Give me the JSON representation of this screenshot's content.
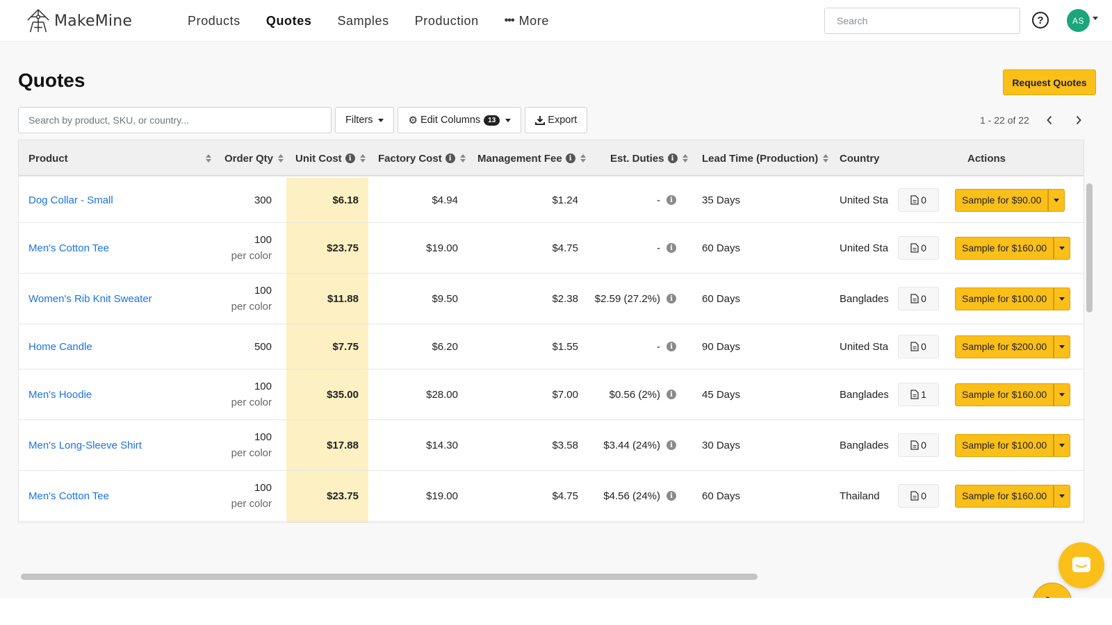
{
  "app": {
    "name": "MakeMine"
  },
  "nav": {
    "items": [
      {
        "label": "Products",
        "active": false
      },
      {
        "label": "Quotes",
        "active": true
      },
      {
        "label": "Samples",
        "active": false
      },
      {
        "label": "Production",
        "active": false
      }
    ],
    "more_label": "More",
    "search_placeholder": "Search",
    "user_initials": "AS",
    "avatar_color": "#1aa57b"
  },
  "page": {
    "title": "Quotes",
    "request_button": "Request Quotes",
    "accent_color": "#fbbf1a"
  },
  "toolbar": {
    "search_placeholder": "Search by product, SKU, or country...",
    "filters_label": "Filters",
    "edit_columns_label": "Edit Columns",
    "edit_columns_count": "13",
    "export_label": "Export",
    "pagination": "1 - 22 of 22"
  },
  "table": {
    "columns": {
      "product": "Product",
      "order_qty": "Order Qty",
      "unit_cost": "Unit Cost",
      "factory_cost": "Factory Cost",
      "management_fee": "Management Fee",
      "est_duties": "Est. Duties",
      "lead_time": "Lead Time (Production)",
      "country": "Country",
      "actions": "Actions"
    },
    "rows": [
      {
        "product": "Dog Collar - Small",
        "qty": "300",
        "qty_sub": "",
        "unit_cost": "$6.18",
        "factory_cost": "$4.94",
        "management_fee": "$1.24",
        "est_duties": "-",
        "lead_time": "35 Days",
        "country": "United States",
        "docs": "0",
        "sample": "Sample for $90.00"
      },
      {
        "product": "Men's Cotton Tee",
        "qty": "100",
        "qty_sub": "per color",
        "unit_cost": "$23.75",
        "factory_cost": "$19.00",
        "management_fee": "$4.75",
        "est_duties": "-",
        "lead_time": "60 Days",
        "country": "United States",
        "docs": "0",
        "sample": "Sample for $160.00"
      },
      {
        "product": "Women's Rib Knit Sweater",
        "qty": "100",
        "qty_sub": "per color",
        "unit_cost": "$11.88",
        "factory_cost": "$9.50",
        "management_fee": "$2.38",
        "est_duties": "$2.59 (27.2%)",
        "lead_time": "60 Days",
        "country": "Bangladesh",
        "docs": "0",
        "sample": "Sample for $100.00"
      },
      {
        "product": "Home Candle",
        "qty": "500",
        "qty_sub": "",
        "unit_cost": "$7.75",
        "factory_cost": "$6.20",
        "management_fee": "$1.55",
        "est_duties": "-",
        "lead_time": "90 Days",
        "country": "United States",
        "docs": "0",
        "sample": "Sample for $200.00"
      },
      {
        "product": "Men's Hoodie",
        "qty": "100",
        "qty_sub": "per color",
        "unit_cost": "$35.00",
        "factory_cost": "$28.00",
        "management_fee": "$7.00",
        "est_duties": "$0.56 (2%)",
        "lead_time": "45 Days",
        "country": "Bangladesh",
        "docs": "1",
        "sample": "Sample for $160.00"
      },
      {
        "product": "Men's Long-Sleeve Shirt",
        "qty": "100",
        "qty_sub": "per color",
        "unit_cost": "$17.88",
        "factory_cost": "$14.30",
        "management_fee": "$3.58",
        "est_duties": "$3.44 (24%)",
        "lead_time": "30 Days",
        "country": "Bangladesh",
        "docs": "0",
        "sample": "Sample for $100.00"
      },
      {
        "product": "Men's Cotton Tee",
        "qty": "100",
        "qty_sub": "per color",
        "unit_cost": "$23.75",
        "factory_cost": "$19.00",
        "management_fee": "$4.75",
        "est_duties": "$4.56 (24%)",
        "lead_time": "60 Days",
        "country": "Thailand",
        "docs": "0",
        "sample": "Sample for $160.00"
      }
    ]
  }
}
